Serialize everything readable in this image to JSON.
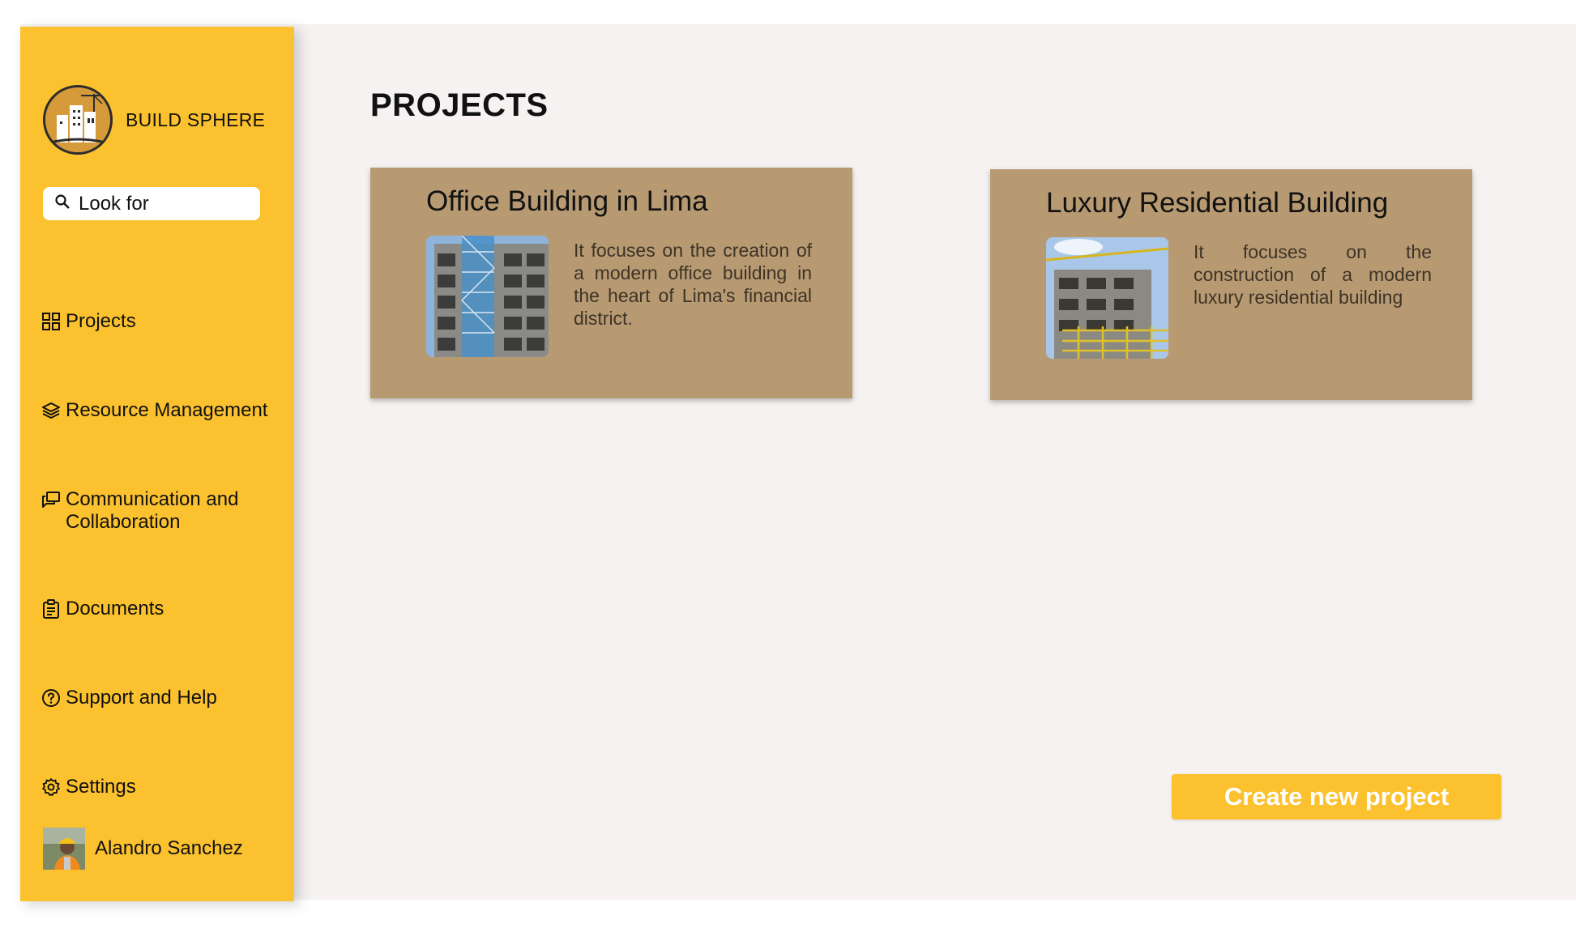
{
  "app": {
    "brand_name": "BUILD SPHERE"
  },
  "search": {
    "placeholder": "Look for"
  },
  "sidebar": {
    "items": [
      {
        "label": "Projects",
        "icon": "grid-icon"
      },
      {
        "label": "Resource Management",
        "icon": "layers-icon"
      },
      {
        "label": "Communication and Collaboration",
        "icon": "chat-icon"
      },
      {
        "label": "Documents",
        "icon": "clipboard-icon"
      },
      {
        "label": "Support and Help",
        "icon": "help-circle-icon"
      },
      {
        "label": "Settings",
        "icon": "gear-icon"
      }
    ],
    "user": {
      "name": "Alandro Sanchez"
    }
  },
  "main": {
    "title": "PROJECTS",
    "projects": [
      {
        "title": "Office Building in Lima",
        "description": "It focuses on the creation of a modern office building in the heart of Lima's financial district."
      },
      {
        "title": "Luxury Residential Building",
        "description": "It focuses on the construction of a modern luxury residential building"
      }
    ],
    "create_button": "Create new project"
  },
  "colors": {
    "sidebar": "#fbc12e",
    "card": "#b89a72",
    "background": "#f5f2f1",
    "button": "#fbc12e"
  }
}
